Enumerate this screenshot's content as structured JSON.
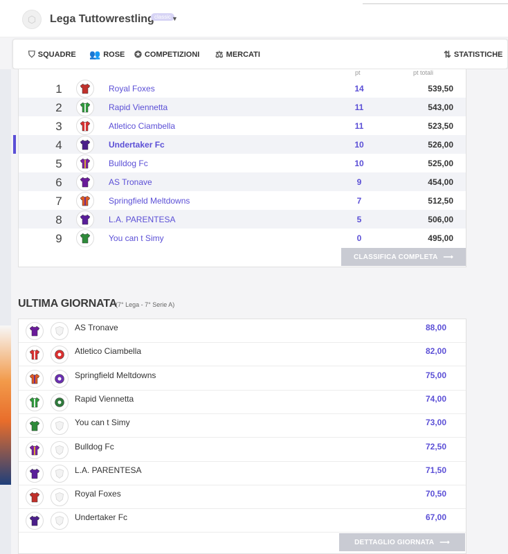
{
  "header": {
    "league_title": "Lega Tuttowrestling",
    "badge": "classic"
  },
  "nav": {
    "squadre": "SQUADRE",
    "rose": "ROSE",
    "competizioni": "COMPETIZIONI",
    "mercati": "MERCATI",
    "statistiche": "STATISTICHE"
  },
  "standings": {
    "col_pt": "pt",
    "col_pt_totali": "pt totali",
    "rows": [
      {
        "rank": "1",
        "team": "Royal Foxes",
        "pt": "14",
        "tot": "539,50",
        "color": "#c0302b",
        "stripe": "#c0302b"
      },
      {
        "rank": "2",
        "team": "Rapid Viennetta",
        "pt": "11",
        "tot": "543,00",
        "color": "#2f9a3c",
        "stripe": "#ffffff"
      },
      {
        "rank": "3",
        "team": "Atletico Ciambella",
        "pt": "11",
        "tot": "523,50",
        "color": "#d93030",
        "stripe": "#ffffff"
      },
      {
        "rank": "4",
        "team": "Undertaker Fc",
        "pt": "10",
        "tot": "526,00",
        "color": "#4b1f8a",
        "stripe": "#4b1f8a"
      },
      {
        "rank": "5",
        "team": "Bulldog Fc",
        "pt": "10",
        "tot": "525,00",
        "color": "#7b1fa2",
        "stripe": "#e8c321"
      },
      {
        "rank": "6",
        "team": "AS Tronave",
        "pt": "9",
        "tot": "454,00",
        "color": "#6a1b9a",
        "stripe": "#6a1b9a"
      },
      {
        "rank": "7",
        "team": "Springfield Meltdowns",
        "pt": "7",
        "tot": "512,50",
        "color": "#e05a22",
        "stripe": "#5a2a9a"
      },
      {
        "rank": "8",
        "team": "L.A. PARENTESA",
        "pt": "5",
        "tot": "506,00",
        "color": "#5a1f9a",
        "stripe": "#5a1f9a"
      },
      {
        "rank": "9",
        "team": "You can t Simy",
        "pt": "0",
        "tot": "495,00",
        "color": "#2e8a3a",
        "stripe": "#2e8a3a"
      }
    ],
    "cta": "CLASSIFICA COMPLETA"
  },
  "last_round": {
    "title": "ULTIMA GIORNATA",
    "subtitle": "(7° Lega - 7° Serie A)",
    "rows": [
      {
        "team": "AS Tronave",
        "score": "88,00",
        "color": "#6a1b9a",
        "stripe": "#6a1b9a",
        "crest": "none"
      },
      {
        "team": "Atletico Ciambella",
        "score": "82,00",
        "color": "#d93030",
        "stripe": "#ffffff",
        "crest": "red"
      },
      {
        "team": "Springfield Meltdowns",
        "score": "75,00",
        "color": "#e05a22",
        "stripe": "#5a2a9a",
        "crest": "purple"
      },
      {
        "team": "Rapid Viennetta",
        "score": "74,00",
        "color": "#2f9a3c",
        "stripe": "#ffffff",
        "crest": "green"
      },
      {
        "team": "You can t Simy",
        "score": "73,00",
        "color": "#2e8a3a",
        "stripe": "#2e8a3a",
        "crest": "none"
      },
      {
        "team": "Bulldog Fc",
        "score": "72,50",
        "color": "#7b1fa2",
        "stripe": "#e8c321",
        "crest": "none"
      },
      {
        "team": "L.A. PARENTESA",
        "score": "71,50",
        "color": "#5a1f9a",
        "stripe": "#5a1f9a",
        "crest": "none"
      },
      {
        "team": "Royal Foxes",
        "score": "70,50",
        "color": "#c0302b",
        "stripe": "#c0302b",
        "crest": "none"
      },
      {
        "team": "Undertaker Fc",
        "score": "67,00",
        "color": "#4b1f8a",
        "stripe": "#4b1f8a",
        "crest": "none"
      }
    ],
    "cta": "DETTAGLIO GIORNATA"
  },
  "icons": {
    "arrow": "long-arrow-right-icon",
    "sort": "sort-icon"
  }
}
